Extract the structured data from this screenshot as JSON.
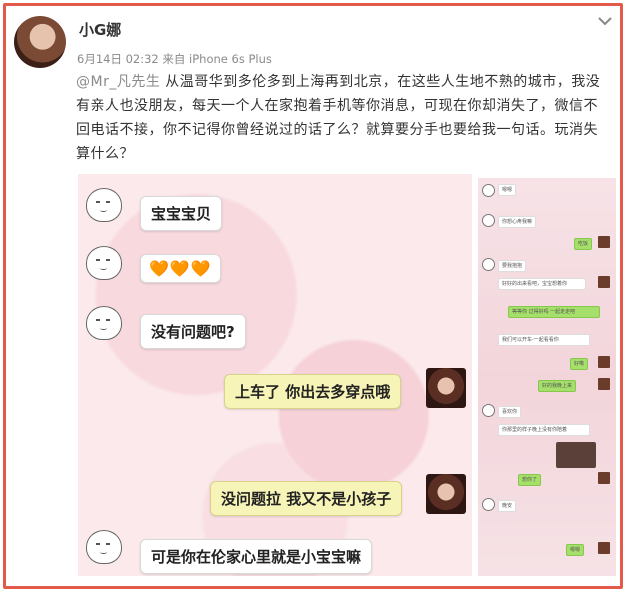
{
  "post": {
    "username": "小G娜",
    "meta": "6月14日 02:32 来自 iPhone 6s Plus",
    "mention": "@Mr_凡先生",
    "body": " 从温哥华到多伦多到上海再到北京，在这些人生地不熟的城市，我没有亲人也没朋友，每天一个人在家抱着手机等你消息，可现在你却消失了，微信不回电话不接，你不记得你曾经说过的话了么？就算要分手也要给我一句话。玩消失算什么？"
  },
  "chat_left": {
    "messages": [
      {
        "side": "left",
        "text": "宝宝宝贝"
      },
      {
        "side": "left",
        "text": "🧡🧡🧡"
      },
      {
        "side": "left",
        "text": "没有问题吧?"
      },
      {
        "side": "right",
        "text": "上车了 你出去多穿点哦"
      },
      {
        "side": "right",
        "text": "没问题拉 我又不是小孩子"
      },
      {
        "side": "left",
        "text": "可是你在伦家心里就是小宝宝嘛"
      }
    ]
  },
  "chat_right": {
    "snippets": [
      "嗯嗯",
      "你想心疼我嘛",
      "吃饭",
      "要我抱抱",
      "好好的出来看吧，宝宝想着你",
      "等等你 过得好吗 一起走走吧",
      "我们可以开车-一起看看你",
      "好嘞",
      "好的我晚上来",
      "喜欢你",
      "你那里的样子晚上没有你陪着",
      "想你了",
      "晚安",
      "嗯嗯"
    ]
  },
  "colors": {
    "frame": "#e25a4a",
    "meta": "#8a8a8a",
    "bubble_green": "#f7f4b8",
    "wechat_green": "#a6e06a"
  },
  "icons": [
    "chevron-down-icon",
    "avatar",
    "emoji-avatar-icon"
  ]
}
